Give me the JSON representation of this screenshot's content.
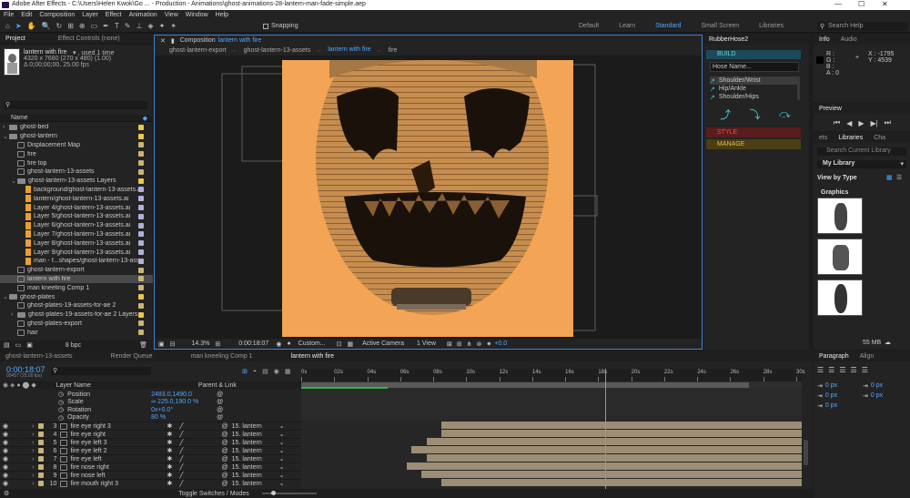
{
  "window": {
    "title": "Adobe After Effects - C:\\Users\\Helen Kwok\\Go ... - Production - Animations\\ghost-animations-28-lantern-man-fade-simple.aep",
    "min": "—",
    "max": "☐",
    "close": "✕"
  },
  "menu": [
    "File",
    "Edit",
    "Composition",
    "Layer",
    "Effect",
    "Animation",
    "View",
    "Window",
    "Help"
  ],
  "toolbar": {
    "snapping": "Snapping",
    "workspaces": [
      "Default",
      "Learn",
      "Standard",
      "Small Screen",
      "Libraries"
    ],
    "active_workspace": "Standard",
    "search_placeholder": "Search Help"
  },
  "project": {
    "tab": "Project",
    "effect_controls": "Effect Controls (none)",
    "selected_name": "lantern with fire",
    "used": "▾ , used 1 time",
    "dims": "4320 x 7680  (270 x 480) (1.00)",
    "duration": "Δ 0;00;00;00, 25.00 fps",
    "col_name": "Name",
    "items": [
      {
        "label": "ghost-bed",
        "depth": 0,
        "type": "folder",
        "color": "#e6c94e",
        "twirl": "›"
      },
      {
        "label": "ghost-lantern",
        "depth": 0,
        "type": "folder",
        "color": "#e6c94e",
        "twirl": "⌄"
      },
      {
        "label": "Displacement Map",
        "depth": 1,
        "type": "comp",
        "color": "#c8b47a",
        "twirl": ""
      },
      {
        "label": "fire",
        "depth": 1,
        "type": "comp",
        "color": "#c8b47a",
        "twirl": ""
      },
      {
        "label": "fire top",
        "depth": 1,
        "type": "comp",
        "color": "#c8b47a",
        "twirl": ""
      },
      {
        "label": "ghost-lantern-13-assets",
        "depth": 1,
        "type": "comp",
        "color": "#c8b47a",
        "twirl": ""
      },
      {
        "label": "ghost-lantern-13-assets Layers",
        "depth": 1,
        "type": "folder",
        "color": "#e6c94e",
        "twirl": "⌄"
      },
      {
        "label": "background/ghost-lantern-13-assets.ai",
        "depth": 2,
        "type": "ai",
        "color": "#b0b0d8",
        "twirl": ""
      },
      {
        "label": "lantern/ghost-lantern-13-assets.ai",
        "depth": 2,
        "type": "ai",
        "color": "#b0b0d8",
        "twirl": ""
      },
      {
        "label": "Layer 4/ghost-lantern-13-assets.ai",
        "depth": 2,
        "type": "ai",
        "color": "#b0b0d8",
        "twirl": ""
      },
      {
        "label": "Layer 5/ghost-lantern-13-assets.ai",
        "depth": 2,
        "type": "ai",
        "color": "#b0b0d8",
        "twirl": ""
      },
      {
        "label": "Layer 6/ghost-lantern-13-assets.ai",
        "depth": 2,
        "type": "ai",
        "color": "#b0b0d8",
        "twirl": ""
      },
      {
        "label": "Layer 7/ghost-lantern-13-assets.ai",
        "depth": 2,
        "type": "ai",
        "color": "#b0b0d8",
        "twirl": ""
      },
      {
        "label": "Layer 8/ghost-lantern-13-assets.ai",
        "depth": 2,
        "type": "ai",
        "color": "#b0b0d8",
        "twirl": ""
      },
      {
        "label": "Layer 9/ghost-lantern-13-assets.ai",
        "depth": 2,
        "type": "ai",
        "color": "#b0b0d8",
        "twirl": ""
      },
      {
        "label": "man - f...shapes/ghost-lantern-13-assets.ai",
        "depth": 2,
        "type": "ai",
        "color": "#b0b0d8",
        "twirl": ""
      },
      {
        "label": "ghost-lantern-export",
        "depth": 1,
        "type": "comp",
        "color": "#c8b47a",
        "twirl": ""
      },
      {
        "label": "lantern with fire",
        "depth": 1,
        "type": "comp",
        "color": "#c8b47a",
        "twirl": "",
        "selected": true
      },
      {
        "label": "man kneeling Comp 1",
        "depth": 1,
        "type": "comp",
        "color": "#c8b47a",
        "twirl": ""
      },
      {
        "label": "ghost-plates",
        "depth": 0,
        "type": "folder",
        "color": "#e6c94e",
        "twirl": "⌄"
      },
      {
        "label": "ghost-plates-19-assets-for-ae 2",
        "depth": 1,
        "type": "comp",
        "color": "#c8b47a",
        "twirl": ""
      },
      {
        "label": "ghost-plates-19-assets-for-ae 2 Layers",
        "depth": 1,
        "type": "folder",
        "color": "#e6c94e",
        "twirl": "›"
      },
      {
        "label": "ghost-plates-export",
        "depth": 1,
        "type": "comp",
        "color": "#c8b47a",
        "twirl": ""
      },
      {
        "label": "hair",
        "depth": 1,
        "type": "comp",
        "color": "#c8b47a",
        "twirl": ""
      }
    ],
    "bpc": "8 bpc"
  },
  "composition": {
    "panel_label": "Composition",
    "comp_name": "lantern with fire",
    "tabs": [
      "ghost-lantern-export",
      "ghost-lantern-13-assets",
      "lantern with fire",
      "fire"
    ],
    "active_tab": "lantern with fire",
    "footer": {
      "zoom": "14.3%",
      "timecode": "0:00:18:07",
      "quality": "Custom...",
      "camera": "Active Camera",
      "view": "1 View",
      "exposure": "+0.0"
    }
  },
  "rubberhose": {
    "title": "RubberHose2",
    "build": "BUILD",
    "hose_name": "Hose Name...",
    "options": [
      "Shoulder/Wrist",
      "Hip/Ankle",
      "Shoulder/Hips"
    ],
    "style": "STYLE",
    "manage": "MANAGE"
  },
  "info": {
    "tab": "Info",
    "audio": "Audio",
    "r": "R :",
    "g": "G :",
    "b": "B :",
    "a": "A : 0",
    "x": "X : -1795",
    "y": "Y : 4539"
  },
  "preview": {
    "tab": "Preview"
  },
  "libraries": {
    "tabs": [
      "ets",
      "Libraries",
      "Cha"
    ],
    "active": "Libraries",
    "search_placeholder": "Search Current Library",
    "library": "My Library",
    "view_by": "View by Type",
    "section": "Graphics",
    "size": "55 MB"
  },
  "paragraph": {
    "tabs": [
      "Paragraph",
      "Align"
    ],
    "fields": [
      "0 px",
      "0 px",
      "0 px",
      "0 px",
      "0 px"
    ]
  },
  "bottom_tabs": [
    "ghost-lantern-13-assets",
    "Render Queue",
    "man kneeling Comp 1",
    "lantern with fire"
  ],
  "timeline": {
    "timecode": "0:00:18:07",
    "frames": "00457 (25.00 fps)",
    "col_layer": "Layer Name",
    "col_parent": "Parent & Link",
    "toggle": "Toggle Switches / Modes",
    "ruler": [
      "0s",
      "02s",
      "04s",
      "06s",
      "08s",
      "10s",
      "12s",
      "14s",
      "16s",
      "18s",
      "20s",
      "22s",
      "24s",
      "26s",
      "28s",
      "30s"
    ],
    "props": [
      {
        "name": "Position",
        "value": "2483.0,1490.0"
      },
      {
        "name": "Scale",
        "value": "∞ 225.0,190.0 %"
      },
      {
        "name": "Rotation",
        "value": "0x+0.0°"
      },
      {
        "name": "Opacity",
        "value": "80 %"
      }
    ],
    "layers": [
      {
        "num": "3",
        "name": "fire eye right 3",
        "parent": "15. lantern",
        "start": 0.28
      },
      {
        "num": "4",
        "name": "fire eye right",
        "parent": "15. lantern",
        "start": 0.28
      },
      {
        "num": "5",
        "name": "fire eye left 3",
        "parent": "15. lantern",
        "start": 0.25
      },
      {
        "num": "6",
        "name": "fire eye left 2",
        "parent": "15. lantern",
        "start": 0.22
      },
      {
        "num": "7",
        "name": "fire eye left",
        "parent": "15. lantern",
        "start": 0.25
      },
      {
        "num": "8",
        "name": "fire nose right",
        "parent": "15. lantern",
        "start": 0.21
      },
      {
        "num": "9",
        "name": "fire nose left",
        "parent": "15. lantern",
        "start": 0.24
      },
      {
        "num": "10",
        "name": "fire mouth right 3",
        "parent": "15. lantern",
        "start": 0.28
      }
    ],
    "playhead": 0.607,
    "work_end": 0.895
  }
}
